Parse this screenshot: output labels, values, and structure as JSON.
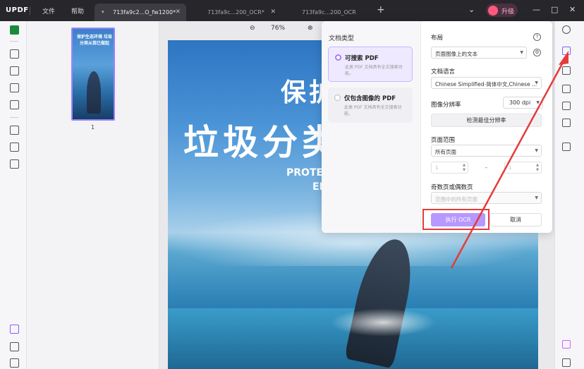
{
  "app": {
    "logo": "UPDF",
    "menu": [
      "文件",
      "帮助"
    ],
    "upgrade_label": "升级",
    "upgrade_avatar_text": "晗"
  },
  "tabs": [
    {
      "label": "713fa9c2...O_fw1200*",
      "active": true
    },
    {
      "label": "713fa9c...200_OCR*",
      "active": false
    },
    {
      "label": "713fa9c...200_OCR",
      "active": false
    }
  ],
  "window_controls": {
    "dropdown": "⌄",
    "minimize": "—",
    "maximize": "□",
    "close": "✕"
  },
  "thumbnail": {
    "page_number": "1",
    "title_text": "保护生态环境 垃圾分类从我已做起"
  },
  "zoom": {
    "zoom_out": "⊖",
    "value": "76%",
    "zoom_in": "⊕"
  },
  "document": {
    "line1": "保护",
    "line2": "垃圾分类",
    "line3": "PROTEC",
    "line4": "EN"
  },
  "ocr_panel": {
    "doc_type_title": "文档类型",
    "options": [
      {
        "title": "可搜索 PDF",
        "desc": "此类 PDF 文档具有全文搜索功能。",
        "selected": true
      },
      {
        "title": "仅包含图像的 PDF",
        "desc": "此类 PDF 文档具有全文搜索功能。",
        "selected": false
      }
    ],
    "layout_label": "布局",
    "layout_value": "页面图像上的文本",
    "language_label": "文档语言",
    "language_value": "Chinese Simplified-简体中文,Chinese ...",
    "resolution_label": "图像分辨率",
    "resolution_value": "300 dpi",
    "detect_button": "检测最佳分辨率",
    "page_range_label": "页面范围",
    "page_range_value": "所有页面",
    "range_from": "1",
    "range_to": "1",
    "range_separator": "-",
    "odd_even_label": "奇数页或偶数页",
    "odd_even_value": "范围中的所有页面",
    "run_button": "执行 OCR",
    "cancel_button": "取消",
    "help_icon_text": "?",
    "settings_icon_text": "⚙"
  },
  "colors": {
    "accent": "#a57cff",
    "run_button": "#b798ff",
    "highlight_box": "#e53b3b",
    "active_left_tool": "#1a8a3a"
  }
}
